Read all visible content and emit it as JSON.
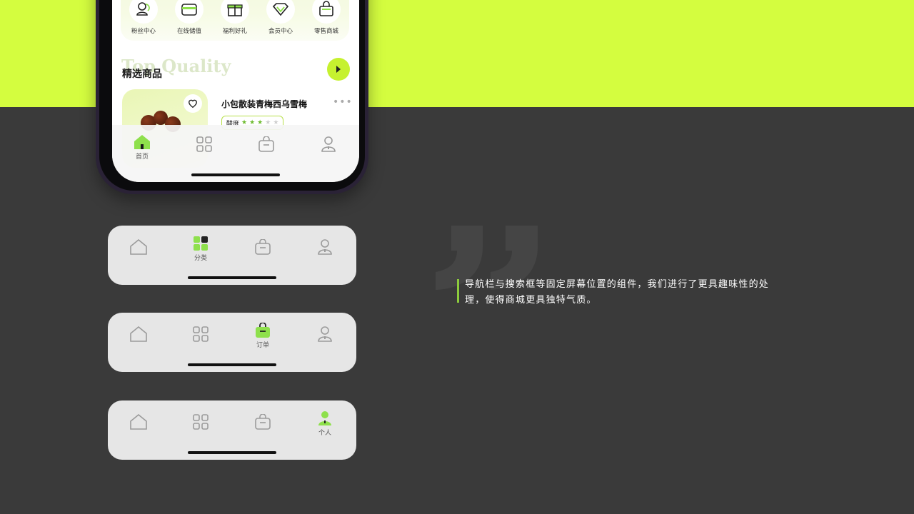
{
  "quick_menu": [
    {
      "label": "粉丝中心",
      "icon": "fans-icon"
    },
    {
      "label": "在线储值",
      "icon": "wallet-icon"
    },
    {
      "label": "福利好礼",
      "icon": "gift-icon"
    },
    {
      "label": "会员中心",
      "icon": "diamond-icon"
    },
    {
      "label": "零售商城",
      "icon": "shopping-bag-icon"
    }
  ],
  "section": {
    "watermark": "Top Quality",
    "title": "精选商品"
  },
  "product": {
    "name": "小包散装青梅西乌雪梅",
    "tag_label": "酸度",
    "acidity_rating": 3,
    "acidity_max": 5
  },
  "tabs": {
    "home": "首页",
    "category": "分类",
    "orders": "订单",
    "profile": "个人"
  },
  "quote": "导航栏与搜索框等固定屏幕位置的组件，我们进行了更具趣味性的处理，使得商城更具独特气质。",
  "colors": {
    "accent": "#d4fd3f",
    "active_icon": "#8ee04c",
    "background": "#3a3a3a",
    "inactive_icon": "#9b9b9b"
  }
}
